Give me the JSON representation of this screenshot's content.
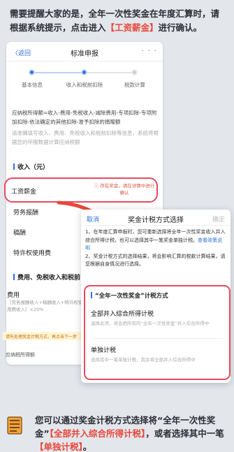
{
  "top_note": {
    "prefix": "需要提醒大家的是，全年一次性奖金在年度汇算时，请根据系统提示，点击进入",
    "highlight": "【工资薪金】",
    "suffix": "进行确认。"
  },
  "nav": {
    "back": "〈返回",
    "title": "标准申报",
    "more": "· · ·"
  },
  "steps": [
    "基本信息",
    "收入和税前扣除",
    "税款计算"
  ],
  "formula": {
    "line1": "应纳税所得额=收入-费用-免税收入-减除费用-专项扣除-专项附加扣除-依法确定的其他扣除-准予扣除的捐赠额",
    "line2": "请准确填写收入、费用、免税收入和税前扣除等信息，系统将根据您的申报数据计算应纳税额"
  },
  "income_section": "收入（元）",
  "income_rows": {
    "wage": "工资薪金",
    "wage_tag": "ⓘ 存在奖金，请在详情中进行确认",
    "labor": "劳务报酬",
    "author": "稿酬",
    "royalty": "特许权使用费"
  },
  "deduction_section": "费用、免税收入和税前",
  "fee": {
    "label": "费用",
    "sub": "（劳务报酬收入+稿酬收入+特许权使用费收入）×20%"
  },
  "warn": "请先处理奖金计税方式，再点击下一步",
  "footer_row": "应纳税所得额",
  "dialog": {
    "cancel": "取消",
    "title": "奖金计税方式选择",
    "ok": "确定",
    "note1": "1、在年度汇算申报时，您可重新选择将全年一次性奖金收入并入综合所得计税，也可以选择其中一笔奖金单独计税。",
    "note1_link": "查看政策说明",
    "note2": "2、奖金计税方式的选择结果，将会影响汇算的税款计算结果，请您根据自身情况进行选择。"
  },
  "method": {
    "heading": "“全年一次性奖金”计税方式",
    "opt1_title": "全部并入综合所得计税",
    "opt1_desc": "选择此项，将会把所有的“全年一次性奖金”并入综合所得中",
    "opt2_title": "单独计税",
    "opt2_desc": "选择其中一笔单独计税，其余将全部并入综合所得中"
  },
  "bottom_note": {
    "part1": "您可以通过奖金计税方式选择将“全年一次性奖金”",
    "hl1": "【全部并入综合所得计税】",
    "part2": "，或者选择其中一笔",
    "hl2": "【单独计税】",
    "part3": "。"
  },
  "colors": {
    "accent_blue": "#2f6fe0",
    "highlight_red": "#e8473a",
    "box_border": "#e84a5f"
  }
}
